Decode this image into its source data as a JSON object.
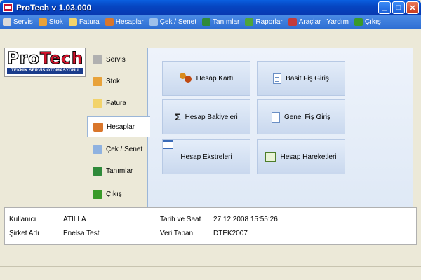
{
  "window": {
    "title": "ProTech v 1.03.000"
  },
  "menu": [
    {
      "label": "Servis",
      "icon": "tools-icon",
      "color": "#d9d9d9"
    },
    {
      "label": "Stok",
      "icon": "boxes-icon",
      "color": "#e8a23a"
    },
    {
      "label": "Fatura",
      "icon": "invoice-icon",
      "color": "#f2d36b"
    },
    {
      "label": "Hesaplar",
      "icon": "people-icon",
      "color": "#d9762b"
    },
    {
      "label": "Çek / Senet",
      "icon": "pen-doc-icon",
      "color": "#9ec0ea"
    },
    {
      "label": "Tanımlar",
      "icon": "gear-diamond-icon",
      "color": "#2f8a3a"
    },
    {
      "label": "Raporlar",
      "icon": "chart-icon",
      "color": "#4ea53a"
    },
    {
      "label": "Araçlar",
      "icon": "wrench-icon",
      "color": "#c23b3b"
    },
    {
      "label": "Yardım",
      "icon": "",
      "color": ""
    },
    {
      "label": "Çıkış",
      "icon": "exit-arrow-icon",
      "color": "#3a9a2a"
    }
  ],
  "logo": {
    "part1": "Pro",
    "part2": "Tech",
    "tagline": "TEKNİK SERVİS OTOMASYONU"
  },
  "nav": {
    "active_index": 3,
    "items": [
      {
        "label": "Servis",
        "icon": "tools-icon",
        "color": "#b0b0b0"
      },
      {
        "label": "Stok",
        "icon": "boxes-icon",
        "color": "#e8a23a"
      },
      {
        "label": "Fatura",
        "icon": "invoice-icon",
        "color": "#f2d36b"
      },
      {
        "label": "Hesaplar",
        "icon": "people-icon",
        "color": "#d9762b"
      },
      {
        "label": "Çek / Senet",
        "icon": "pen-doc-icon",
        "color": "#8fb2e0"
      },
      {
        "label": "Tanımlar",
        "icon": "gear-diamond-icon",
        "color": "#2f8a3a"
      },
      {
        "label": "Çıkış",
        "icon": "exit-arrow-icon",
        "color": "#3a9a2a"
      }
    ]
  },
  "actions": [
    {
      "label": "Hesap Kartı",
      "icon": "people-icon"
    },
    {
      "label": "Basit Fiş Giriş",
      "icon": "document-icon"
    },
    {
      "label": "Hesap Bakiyeleri",
      "icon": "sigma-icon"
    },
    {
      "label": "Genel Fiş Giriş",
      "icon": "document-icon"
    },
    {
      "label": "Hesap Ekstreleri",
      "icon": "window-icon"
    },
    {
      "label": "Hesap Hareketleri",
      "icon": "spreadsheet-icon"
    }
  ],
  "info": {
    "user_label": "Kullanıcı",
    "user_value": "ATILLA",
    "company_label": "Şirket Adı",
    "company_value": "Enelsa Test",
    "datetime_label": "Tarih ve Saat",
    "datetime_value": "27.12.2008 15:55:26",
    "db_label": "Veri Tabanı",
    "db_value": "DTEK2007"
  }
}
